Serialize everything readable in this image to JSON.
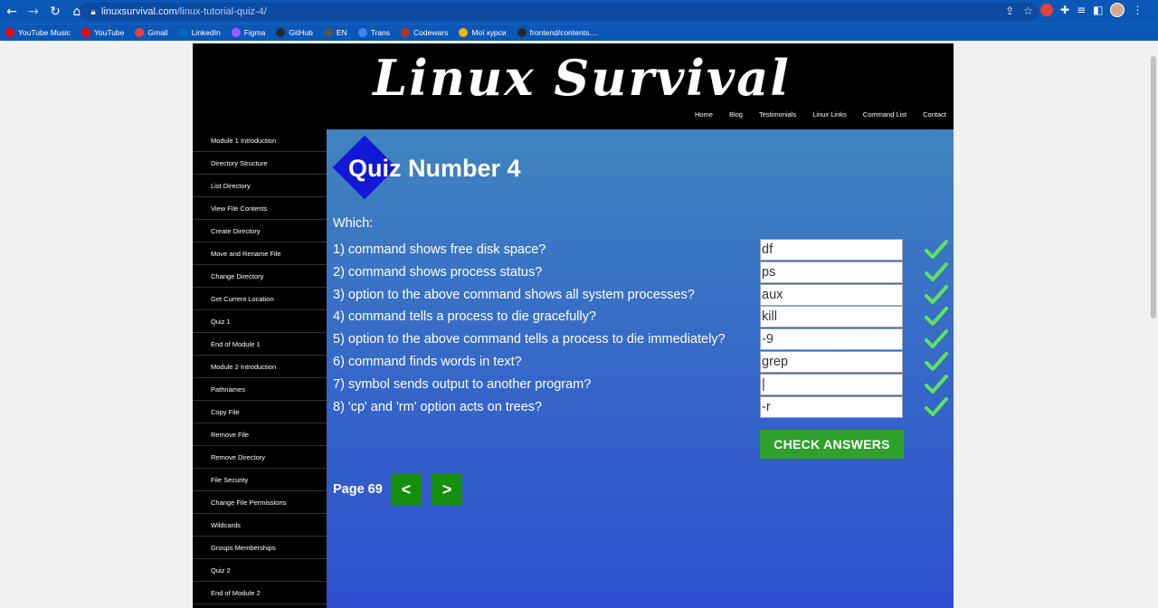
{
  "browser": {
    "url_host": "linuxsurvival.com",
    "url_path": "/linux-tutorial-quiz-4/",
    "bookmarks": [
      {
        "label": "YouTube Music",
        "color": "#ff0000"
      },
      {
        "label": "YouTube",
        "color": "#ff0000"
      },
      {
        "label": "Gmail",
        "color": "#ea4335"
      },
      {
        "label": "LinkedIn",
        "color": "#0a66c2"
      },
      {
        "label": "Figma",
        "color": "#a259ff"
      },
      {
        "label": "GitHub",
        "color": "#24292e"
      },
      {
        "label": "EN",
        "color": "#555555"
      },
      {
        "label": "Trans",
        "color": "#4285f4"
      },
      {
        "label": "Codewars",
        "color": "#b1361e"
      },
      {
        "label": "Мої курси",
        "color": "#f4b400"
      },
      {
        "label": "frontend/contents....",
        "color": "#24292e"
      }
    ]
  },
  "site": {
    "logo": "Linux Survival",
    "nav": [
      "Home",
      "Blog",
      "Testimonials",
      "Linux Links",
      "Command List",
      "Contact"
    ],
    "sidebar": [
      "Module 1 Introduction",
      "Directory Structure",
      "List Directory",
      "View File Contents",
      "Create Directory",
      "Move and Rename File",
      "Change Directory",
      "Get Current Location",
      "Quiz 1",
      "End of Module 1",
      "Module 2 Introduction",
      "Pathnames",
      "Copy File",
      "Remove File",
      "Remove Directory",
      "File Security",
      "Change File Permissions",
      "Wildcards",
      "Groups Memberships",
      "Quiz 2",
      "End of Module 2"
    ]
  },
  "quiz": {
    "title": "Quiz Number 4",
    "intro": "Which:",
    "questions": [
      {
        "text": "1) command shows free disk space?",
        "answer": "df",
        "correct": true
      },
      {
        "text": "2) command shows process status?",
        "answer": "ps",
        "correct": true
      },
      {
        "text": "3) option to the above command shows all system processes?",
        "answer": "aux",
        "correct": true
      },
      {
        "text": "4) command tells a process to die gracefully?",
        "answer": "kill",
        "correct": true
      },
      {
        "text": "5) option to the above command tells a process to die immediately?",
        "answer": "-9",
        "correct": true
      },
      {
        "text": "6) command finds words in text?",
        "answer": "grep",
        "correct": true
      },
      {
        "text": "7) symbol sends output to another program?",
        "answer": "|",
        "correct": true
      },
      {
        "text": "8) 'cp' and 'rm' option acts on trees?",
        "answer": "-r",
        "correct": true
      }
    ],
    "check_button": "CHECK ANSWERS",
    "page_label": "Page 69",
    "prev_label": "<",
    "next_label": ">"
  },
  "colors": {
    "check_mark": "#5fe35a",
    "accent_green": "#2fa02c"
  }
}
